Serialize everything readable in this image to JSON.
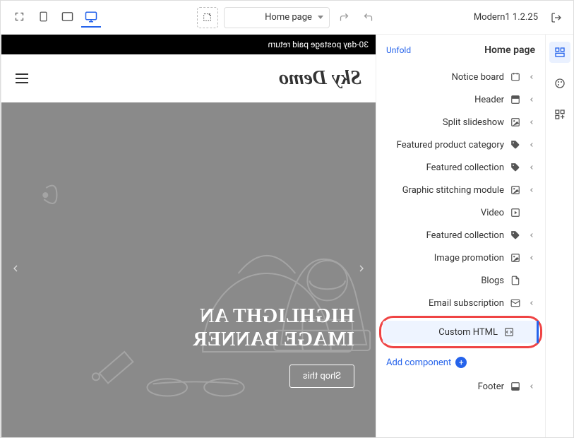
{
  "toolbar": {
    "theme_name": "Modern1 1.2.25",
    "page_select_label": "Home page"
  },
  "sidebar": {
    "title": "Home page",
    "unfold_label": "Unfold",
    "items": [
      {
        "label": "Notice board",
        "icon": "board",
        "chev": true
      },
      {
        "label": "Header",
        "icon": "layout",
        "chev": true
      },
      {
        "label": "Split slideshow",
        "icon": "image",
        "chev": true
      },
      {
        "label": "Featured product category",
        "icon": "tag",
        "chev": true
      },
      {
        "label": "Featured collection",
        "icon": "tag",
        "chev": true
      },
      {
        "label": "Graphic stitching module",
        "icon": "image",
        "chev": true
      },
      {
        "label": "Video",
        "icon": "play",
        "chev": false
      },
      {
        "label": "Featured collection",
        "icon": "tag",
        "chev": true
      },
      {
        "label": "Image promotion",
        "icon": "image",
        "chev": true
      },
      {
        "label": "Blogs",
        "icon": "doc",
        "chev": false
      },
      {
        "label": "Email subscription",
        "icon": "mail",
        "chev": true
      },
      {
        "label": "Custom HTML",
        "icon": "code",
        "chev": false,
        "active": true,
        "highlight": true
      }
    ],
    "add_label": "Add component",
    "footer_label": "Footer"
  },
  "preview": {
    "banner_text": "30-day postage paid return",
    "site_name": "Sky Demo",
    "hero_title_line1": "HIGHLIGHT AN",
    "hero_title_line2": "IMAGE BANNER",
    "hero_button": "Shop this"
  }
}
